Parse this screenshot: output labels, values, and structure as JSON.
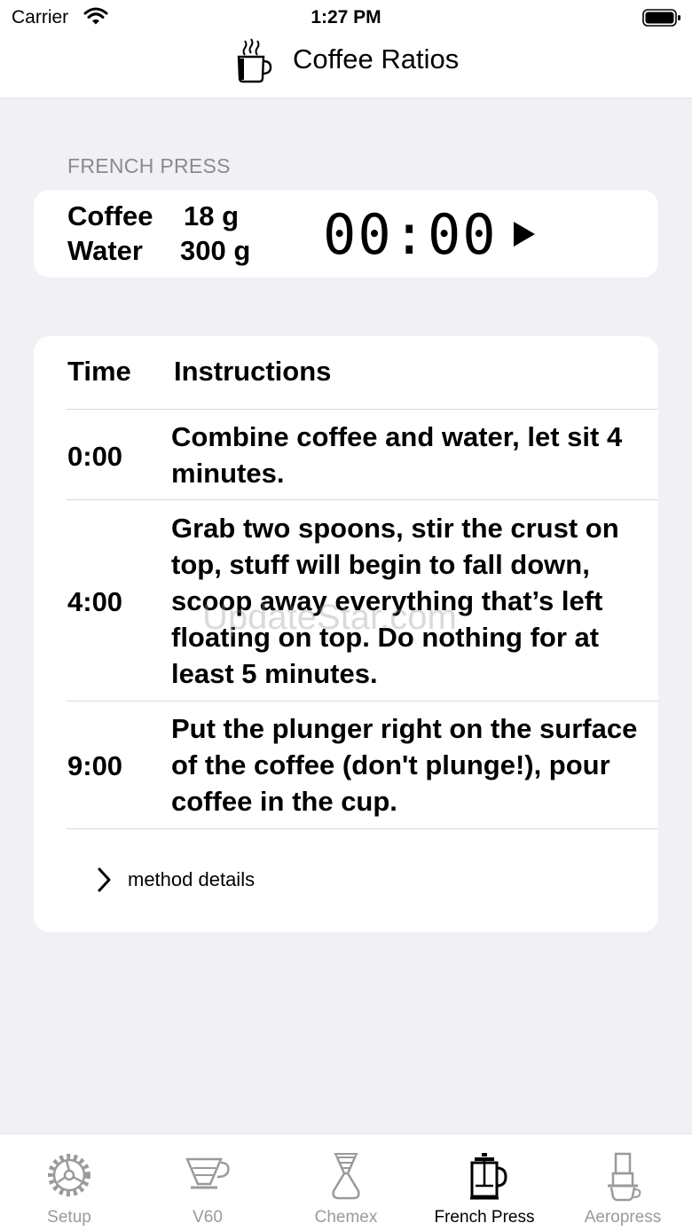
{
  "status_bar": {
    "carrier": "Carrier",
    "time": "1:27 PM"
  },
  "nav": {
    "title": "Coffee Ratios",
    "icon": "coffee-mug-icon"
  },
  "section": {
    "label": "FRENCH PRESS"
  },
  "ratio": {
    "coffee_label": "Coffee",
    "coffee_value": "18 g",
    "water_label": "Water",
    "water_value": "300 g",
    "timer": "00:00"
  },
  "table": {
    "col_time": "Time",
    "col_instructions": "Instructions",
    "steps": [
      {
        "time": "0:00",
        "text": "Combine coffee and water, let sit 4 minutes."
      },
      {
        "time": "4:00",
        "text": "Grab two spoons, stir the crust on top, stuff will begin to fall down, scoop away everything that’s left floating on top. Do nothing for at least 5 minutes."
      },
      {
        "time": "9:00",
        "text": "Put the plunger right on the surface of the coffee (don't plunge!), pour coffee in the cup."
      }
    ],
    "details_label": "method details"
  },
  "tabs": [
    {
      "label": "Setup",
      "icon": "gear-icon"
    },
    {
      "label": "V60",
      "icon": "v60-dripper-icon"
    },
    {
      "label": "Chemex",
      "icon": "chemex-icon"
    },
    {
      "label": "French Press",
      "icon": "french-press-icon"
    },
    {
      "label": "Aeropress",
      "icon": "aeropress-icon"
    }
  ],
  "active_tab": "French Press",
  "watermark": "UpdateStar.com",
  "colors": {
    "background": "#f0f0f5",
    "card": "#ffffff",
    "inactive_tab": "#9a9a9e",
    "section_label": "#8a8a8f"
  }
}
